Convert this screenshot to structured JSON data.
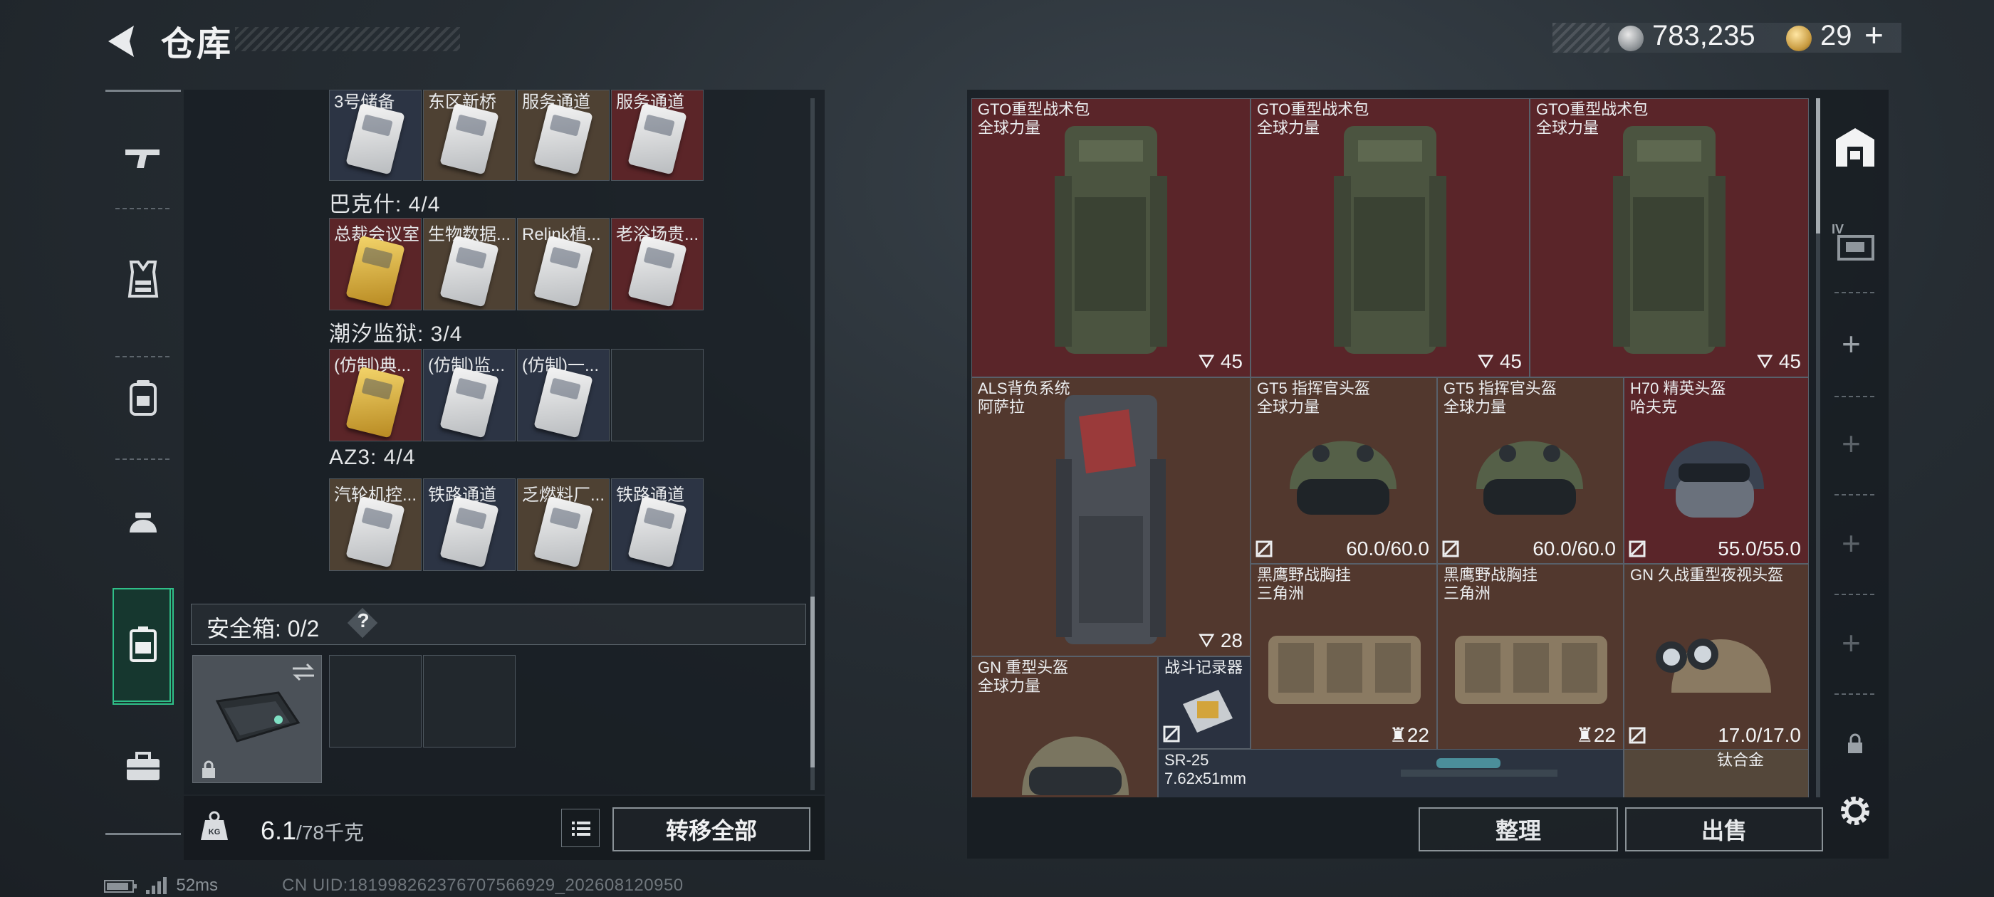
{
  "header": {
    "title": "仓库",
    "silver": "783,235",
    "gold": "29",
    "gold_plus": "+"
  },
  "nav": {
    "items": [
      "weapons-icon",
      "vest-icon",
      "backpack-icon",
      "helmet-icon",
      "case-icon",
      "briefcase-icon"
    ],
    "active": "case-icon"
  },
  "keycards": {
    "row0": [
      "3号储备",
      "东区新桥",
      "服务通道",
      "服务通道"
    ],
    "groups": [
      {
        "label": "巴克什: 4/4",
        "cards": [
          "总裁会议室",
          "生物数据...",
          "Relink植...",
          "老浴场贵..."
        ]
      },
      {
        "label": "潮汐监狱: 3/4",
        "cards": [
          "(仿制)典...",
          "(仿制)监...",
          "(仿制)一...",
          ""
        ]
      },
      {
        "label": "AZ3: 4/4",
        "cards": [
          "汽轮机控...",
          "铁路通道",
          "乏燃料厂...",
          "铁路通道"
        ]
      }
    ]
  },
  "safebox": {
    "label": "安全箱: 0/2",
    "help": "?"
  },
  "weight": {
    "value": "6.1",
    "max": "/78千克",
    "kg_label": "KG"
  },
  "buttons": {
    "transfer_all": "转移全部",
    "sort": "整理",
    "sell": "出售"
  },
  "status": {
    "ping": "52ms",
    "uid": "CN UID:1819982623767075669​29_202608120950"
  },
  "items": [
    {
      "name": "GTO重型战术包",
      "sub": "全球力量",
      "stat": "45"
    },
    {
      "name": "GTO重型战术包",
      "sub": "全球力量",
      "stat": "45"
    },
    {
      "name": "GTO重型战术包",
      "sub": "全球力量",
      "stat": "45"
    },
    {
      "name": "ALS背负系统",
      "sub": "阿萨拉",
      "stat": "28"
    },
    {
      "name": "GT5 指挥官头盔",
      "sub": "全球力量",
      "stat": "60.0/60.0"
    },
    {
      "name": "GT5 指挥官头盔",
      "sub": "全球力量",
      "stat": "60.0/60.0"
    },
    {
      "name": "H70 精英头盔",
      "sub": "哈夫克",
      "stat": "55.0/55.0"
    },
    {
      "name": "黑鹰野战胸挂",
      "sub": "三角洲",
      "stat": "22"
    },
    {
      "name": "黑鹰野战胸挂",
      "sub": "三角洲",
      "stat": "22"
    },
    {
      "name": "GN 久战重型夜视头盔",
      "sub": "",
      "stat": "17.0/17.0"
    },
    {
      "name": "GN 重型头盔",
      "sub": "全球力量",
      "stat": ""
    },
    {
      "name": "战斗记录器",
      "sub": "",
      "stat": ""
    },
    {
      "name": "SR-25",
      "sub": "7.62x51mm",
      "stat": ""
    },
    {
      "name": "钛合金",
      "sub": "",
      "stat": ""
    }
  ],
  "right_nav": {
    "tier_label": "IV",
    "plus": "+"
  }
}
